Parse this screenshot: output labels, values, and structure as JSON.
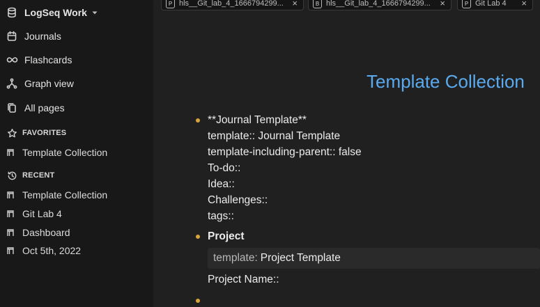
{
  "sidebar": {
    "graph_name": "LogSeq Work",
    "nav": [
      {
        "label": "Journals",
        "icon": "calendar-icon"
      },
      {
        "label": "Flashcards",
        "icon": "infinity-icon"
      },
      {
        "label": "Graph view",
        "icon": "graph-icon"
      },
      {
        "label": "All pages",
        "icon": "pages-icon"
      }
    ],
    "favorites_label": "FAVORITES",
    "favorites": [
      "Template Collection"
    ],
    "recent_label": "RECENT",
    "recent": [
      "Template Collection",
      "Git Lab 4",
      "Dashboard",
      "Oct 5th, 2022"
    ]
  },
  "tabs": [
    {
      "badge": "P",
      "label": "hls__Git_lab_4_1666794299..."
    },
    {
      "badge": "B",
      "label": "hls__Git_lab_4_1666794299..."
    },
    {
      "badge": "P",
      "label": "Git Lab 4"
    }
  ],
  "tab_close_glyph": "×",
  "page": {
    "title": "Template Collection",
    "block1": [
      "**Journal Template**",
      "template:: Journal Template",
      "template-including-parent:: false",
      "To-do::",
      "Idea::",
      "Challenges::",
      "tags::"
    ],
    "block2": {
      "title": "Project",
      "prop_key": "template:",
      "prop_value": "Project Template",
      "line": "Project Name::"
    }
  },
  "colors": {
    "accent_title": "#5aaaef",
    "bullet": "#d9a43c",
    "sidebar_bg": "#181818",
    "main_bg": "#202020"
  }
}
